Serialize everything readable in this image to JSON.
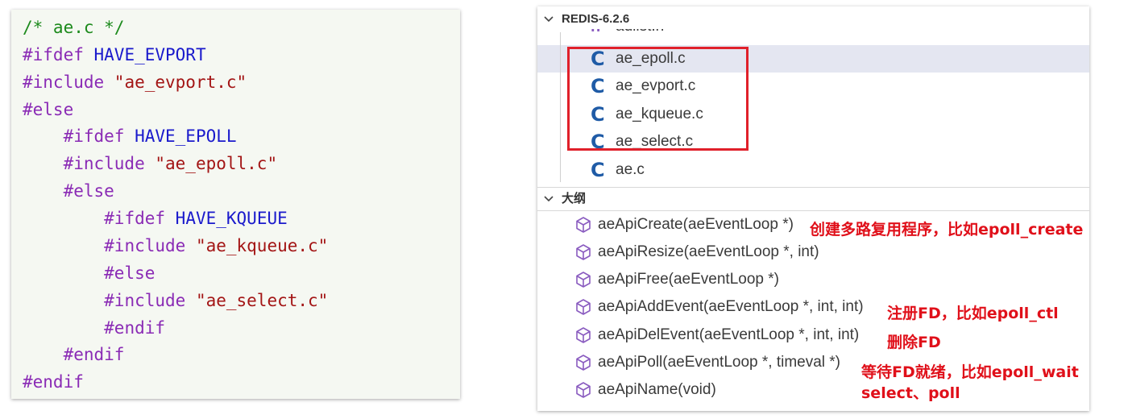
{
  "code": {
    "lines": [
      {
        "tokens": [
          {
            "t": "comment",
            "v": "/* ae.c */"
          }
        ]
      },
      {
        "tokens": [
          {
            "t": "directive",
            "v": "#ifdef "
          },
          {
            "t": "macro",
            "v": "HAVE_EVPORT"
          }
        ]
      },
      {
        "tokens": [
          {
            "t": "directive",
            "v": "#include "
          },
          {
            "t": "string",
            "v": "\"ae_evport.c\""
          }
        ]
      },
      {
        "tokens": [
          {
            "t": "directive",
            "v": "#else"
          }
        ]
      },
      {
        "tokens": [
          {
            "t": "plain",
            "v": "    "
          },
          {
            "t": "directive",
            "v": "#ifdef "
          },
          {
            "t": "macro",
            "v": "HAVE_EPOLL"
          }
        ]
      },
      {
        "tokens": [
          {
            "t": "plain",
            "v": "    "
          },
          {
            "t": "directive",
            "v": "#include "
          },
          {
            "t": "string",
            "v": "\"ae_epoll.c\""
          }
        ]
      },
      {
        "tokens": [
          {
            "t": "plain",
            "v": "    "
          },
          {
            "t": "directive",
            "v": "#else"
          }
        ]
      },
      {
        "tokens": [
          {
            "t": "plain",
            "v": "        "
          },
          {
            "t": "directive",
            "v": "#ifdef "
          },
          {
            "t": "macro",
            "v": "HAVE_KQUEUE"
          }
        ]
      },
      {
        "tokens": [
          {
            "t": "plain",
            "v": "        "
          },
          {
            "t": "directive",
            "v": "#include "
          },
          {
            "t": "string",
            "v": "\"ae_kqueue.c\""
          }
        ]
      },
      {
        "tokens": [
          {
            "t": "plain",
            "v": "        "
          },
          {
            "t": "directive",
            "v": "#else"
          }
        ]
      },
      {
        "tokens": [
          {
            "t": "plain",
            "v": "        "
          },
          {
            "t": "directive",
            "v": "#include "
          },
          {
            "t": "string",
            "v": "\"ae_select.c\""
          }
        ]
      },
      {
        "tokens": [
          {
            "t": "plain",
            "v": "        "
          },
          {
            "t": "directive",
            "v": "#endif"
          }
        ]
      },
      {
        "tokens": [
          {
            "t": "plain",
            "v": "    "
          },
          {
            "t": "directive",
            "v": "#endif"
          }
        ]
      },
      {
        "tokens": [
          {
            "t": "directive",
            "v": "#endif"
          }
        ]
      }
    ]
  },
  "explorer": {
    "title": "REDIS-6.2.6",
    "partial_file": "adlist.h",
    "partial_icon": "h-file-icon",
    "files": [
      {
        "icon": "C",
        "name": "ae_epoll.c"
      },
      {
        "icon": "C",
        "name": "ae_evport.c"
      },
      {
        "icon": "C",
        "name": "ae_kqueue.c"
      },
      {
        "icon": "C",
        "name": "ae_select.c"
      },
      {
        "icon": "C",
        "name": "ae.c"
      }
    ]
  },
  "outline": {
    "title": "大纲",
    "items": [
      {
        "label": "aeApiCreate(aeEventLoop *)"
      },
      {
        "label": "aeApiResize(aeEventLoop *, int)"
      },
      {
        "label": "aeApiFree(aeEventLoop *)"
      },
      {
        "label": "aeApiAddEvent(aeEventLoop *, int, int)"
      },
      {
        "label": "aeApiDelEvent(aeEventLoop *, int, int)"
      },
      {
        "label": "aeApiPoll(aeEventLoop *, timeval *)"
      },
      {
        "label": "aeApiName(void)"
      }
    ]
  },
  "annotations": {
    "create": "创建多路复用程序，比如epoll_create",
    "add": "注册FD，比如epoll_ctl",
    "del": "删除FD",
    "poll_line1": "等待FD就绪，比如epoll_wait",
    "poll_line2": "select、poll"
  },
  "colors": {
    "annotation": "#e0101a",
    "highlight_box": "#e0202a",
    "c_icon": "#1f5ba6",
    "cube_icon": "#8a5cc0"
  }
}
